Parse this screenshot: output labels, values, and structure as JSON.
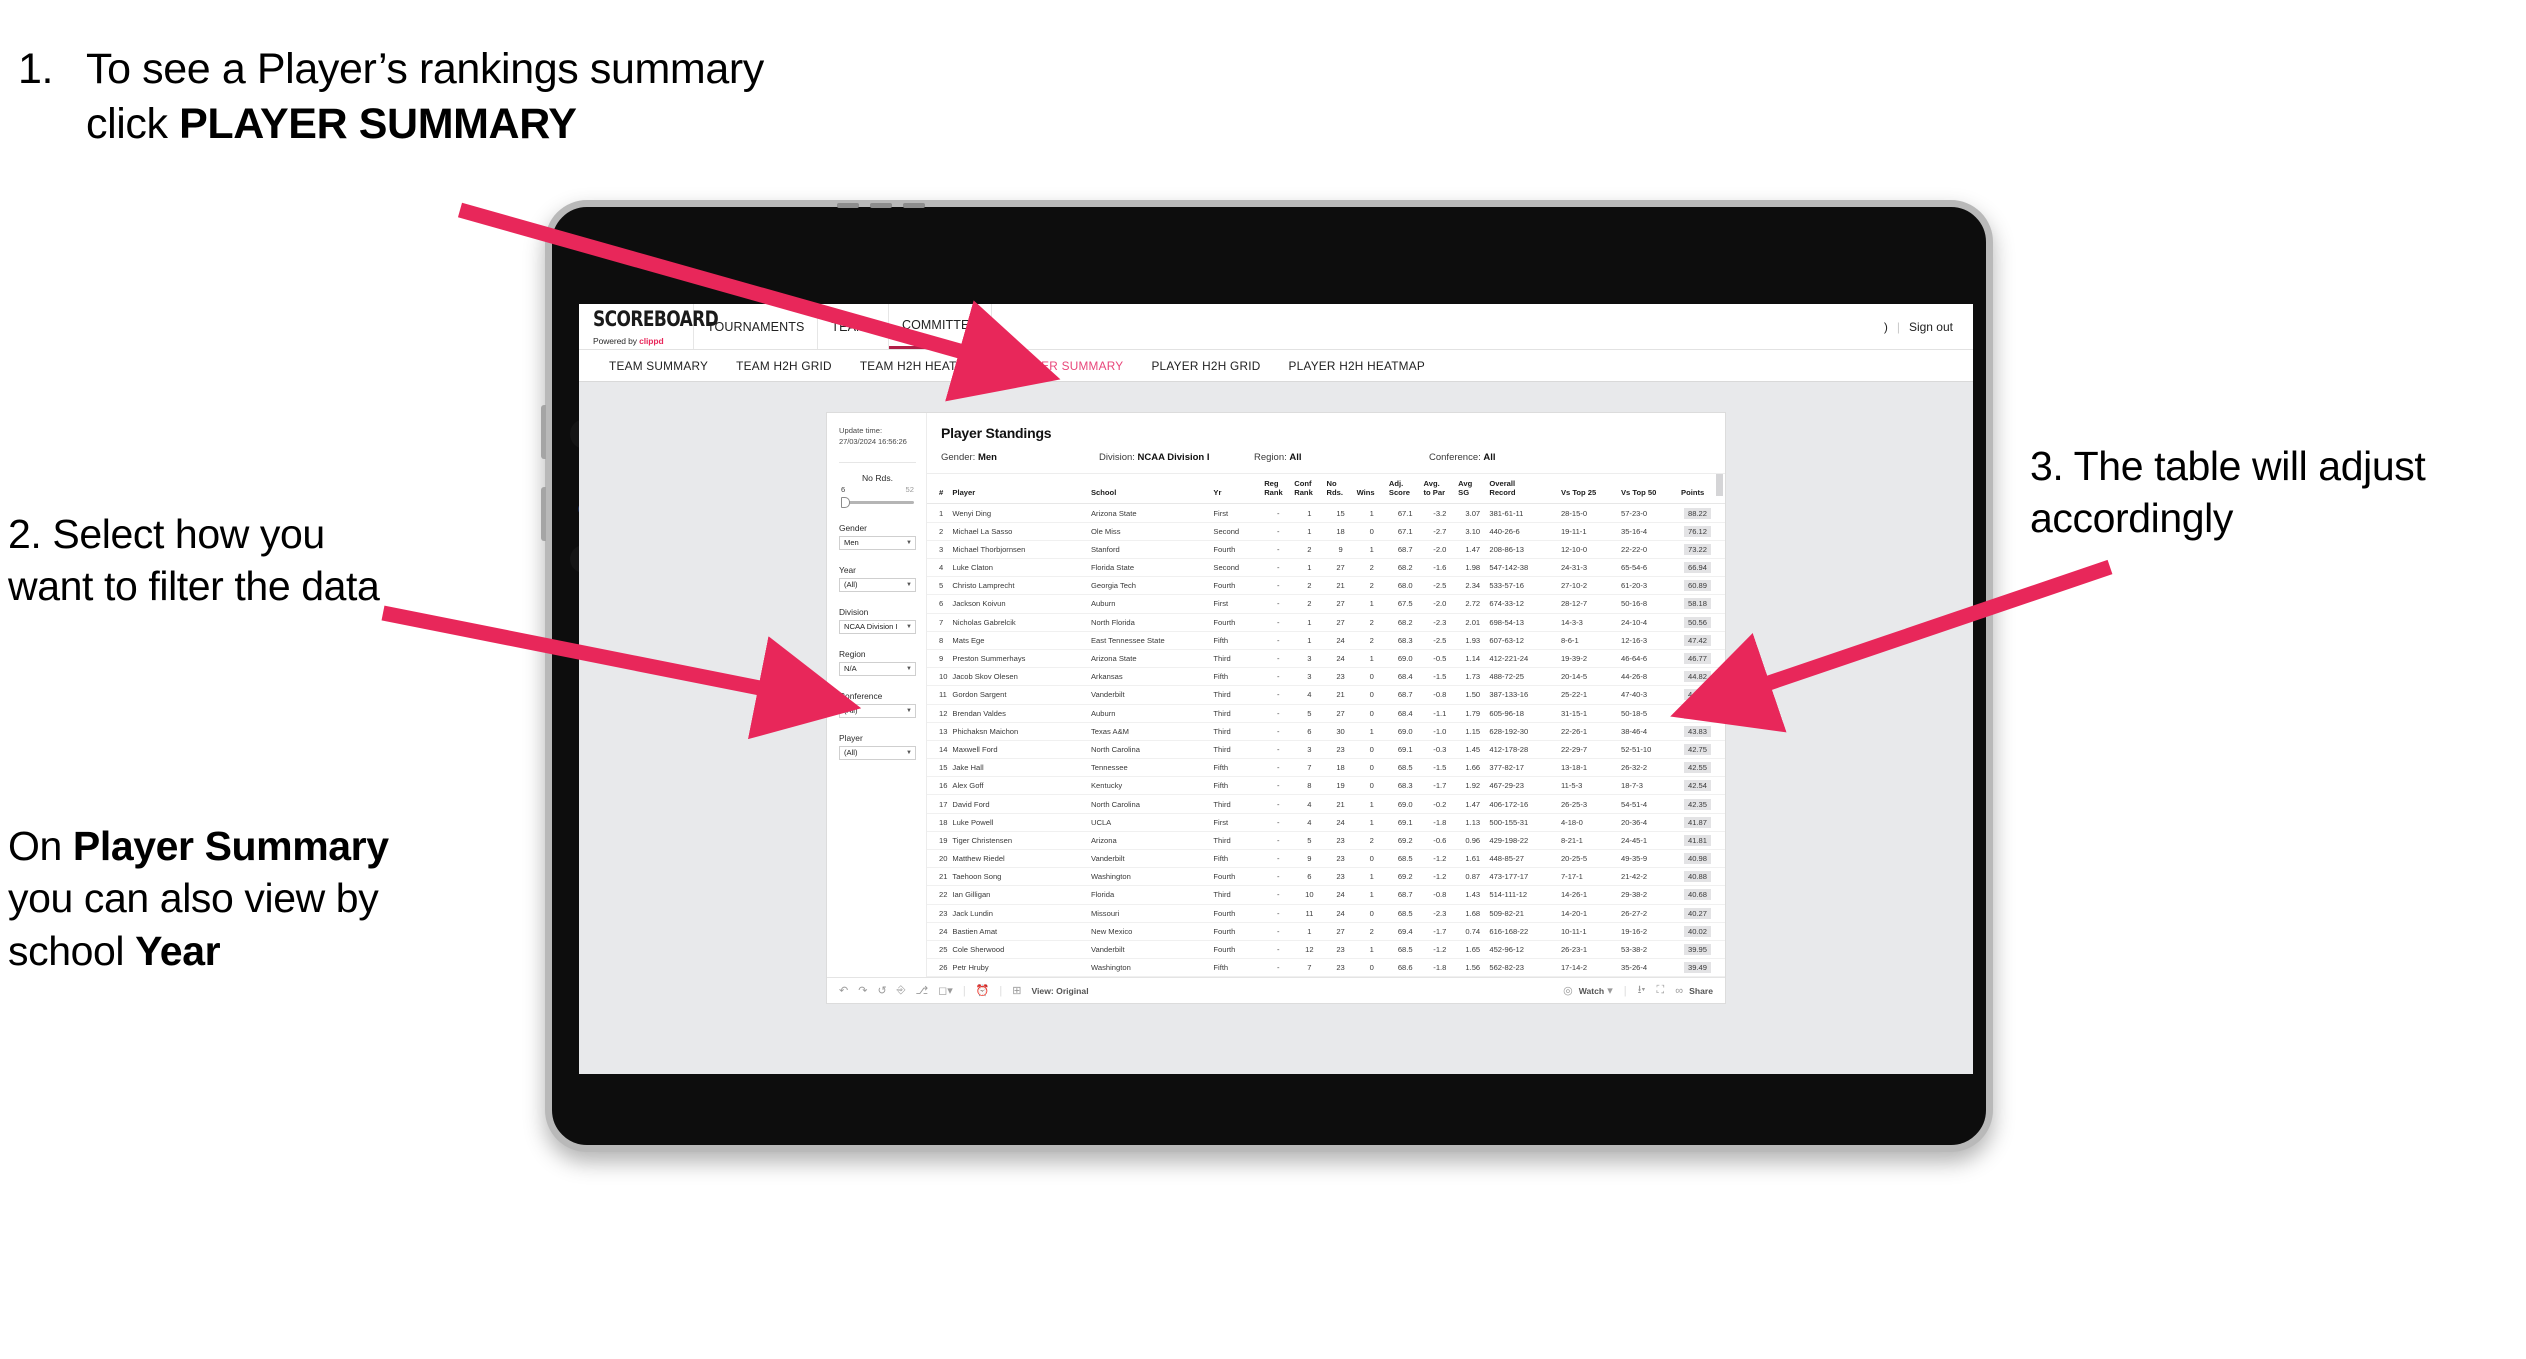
{
  "annotations": {
    "step1_num": "1.",
    "step1_pre": "To see a Player’s rankings summary click ",
    "step1_bold": "PLAYER SUMMARY",
    "step2": "2. Select how you want to filter the data",
    "step2b_pre": "On ",
    "step2b_bold1": "Player Summary",
    "step2b_mid": " you can also view by school ",
    "step2b_bold2": "Year",
    "step3": "3. The table will adjust accordingly",
    "arrow_color": "#e8275a"
  },
  "app": {
    "brand": {
      "name": "SCOREBOARD",
      "powered_pre": "Powered by ",
      "powered_brand": "clippd"
    },
    "top_nav": [
      {
        "label": "TOURNAMENTS",
        "active": false
      },
      {
        "label": "TEAMS",
        "active": false
      },
      {
        "label": "COMMITTEE",
        "active": true
      }
    ],
    "account": {
      "user_glyph": ")",
      "divider": "|",
      "sign_out": "Sign out"
    },
    "sub_nav": [
      {
        "label": "TEAM SUMMARY",
        "active": false
      },
      {
        "label": "TEAM H2H GRID",
        "active": false
      },
      {
        "label": "TEAM H2H HEATMAP",
        "active": false
      },
      {
        "label": "PLAYER SUMMARY",
        "active": true
      },
      {
        "label": "PLAYER H2H GRID",
        "active": false
      },
      {
        "label": "PLAYER H2H HEATMAP",
        "active": false
      }
    ]
  },
  "filters": {
    "update_label": "Update time:",
    "update_value": "27/03/2024 16:56:26",
    "slider": {
      "label": "No Rds.",
      "min": "6",
      "max": "52"
    },
    "selects": [
      {
        "label": "Gender",
        "value": "Men"
      },
      {
        "label": "Year",
        "value": "(All)"
      },
      {
        "label": "Division",
        "value": "NCAA Division I"
      },
      {
        "label": "Region",
        "value": "N/A"
      },
      {
        "label": "Conference",
        "value": "(All)"
      },
      {
        "label": "Player",
        "value": "(All)"
      }
    ]
  },
  "standings": {
    "title": "Player Standings",
    "meta": [
      {
        "label": "Gender: ",
        "value": "Men"
      },
      {
        "label": "Division: ",
        "value": "NCAA Division I"
      },
      {
        "label": "Region: ",
        "value": "All"
      },
      {
        "label": "Conference: ",
        "value": "All"
      }
    ],
    "columns": [
      {
        "l1": "#",
        "l2": ""
      },
      {
        "l1": "Player",
        "l2": ""
      },
      {
        "l1": "School",
        "l2": ""
      },
      {
        "l1": "Yr",
        "l2": ""
      },
      {
        "l1": "Reg",
        "l2": "Rank"
      },
      {
        "l1": "Conf",
        "l2": "Rank"
      },
      {
        "l1": "No",
        "l2": "Rds."
      },
      {
        "l1": "Wins",
        "l2": ""
      },
      {
        "l1": "Adj.",
        "l2": "Score"
      },
      {
        "l1": "Avg.",
        "l2": "to Par"
      },
      {
        "l1": "Avg",
        "l2": "SG"
      },
      {
        "l1": "Overall",
        "l2": "Record"
      },
      {
        "l1": "Vs Top 25",
        "l2": ""
      },
      {
        "l1": "Vs Top 50",
        "l2": ""
      },
      {
        "l1": "Points",
        "l2": ""
      }
    ],
    "rows": [
      {
        "rank": "1",
        "player": "Wenyi Ding",
        "school": "Arizona State",
        "yr": "First",
        "reg": "-",
        "conf": "1",
        "rds": "15",
        "wins": "1",
        "adj": "67.1",
        "par": "-3.2",
        "sg": "3.07",
        "record": "381-61-11",
        "t25": "28-15-0",
        "t50": "57-23-0",
        "points": "88.22"
      },
      {
        "rank": "2",
        "player": "Michael La Sasso",
        "school": "Ole Miss",
        "yr": "Second",
        "reg": "-",
        "conf": "1",
        "rds": "18",
        "wins": "0",
        "adj": "67.1",
        "par": "-2.7",
        "sg": "3.10",
        "record": "440-26-6",
        "t25": "19-11-1",
        "t50": "35-16-4",
        "points": "76.12"
      },
      {
        "rank": "3",
        "player": "Michael Thorbjornsen",
        "school": "Stanford",
        "yr": "Fourth",
        "reg": "-",
        "conf": "2",
        "rds": "9",
        "wins": "1",
        "adj": "68.7",
        "par": "-2.0",
        "sg": "1.47",
        "record": "208-86-13",
        "t25": "12-10-0",
        "t50": "22-22-0",
        "points": "73.22"
      },
      {
        "rank": "4",
        "player": "Luke Claton",
        "school": "Florida State",
        "yr": "Second",
        "reg": "-",
        "conf": "1",
        "rds": "27",
        "wins": "2",
        "adj": "68.2",
        "par": "-1.6",
        "sg": "1.98",
        "record": "547-142-38",
        "t25": "24-31-3",
        "t50": "65-54-6",
        "points": "66.94"
      },
      {
        "rank": "5",
        "player": "Christo Lamprecht",
        "school": "Georgia Tech",
        "yr": "Fourth",
        "reg": "-",
        "conf": "2",
        "rds": "21",
        "wins": "2",
        "adj": "68.0",
        "par": "-2.5",
        "sg": "2.34",
        "record": "533-57-16",
        "t25": "27-10-2",
        "t50": "61-20-3",
        "points": "60.89"
      },
      {
        "rank": "6",
        "player": "Jackson Koivun",
        "school": "Auburn",
        "yr": "First",
        "reg": "-",
        "conf": "2",
        "rds": "27",
        "wins": "1",
        "adj": "67.5",
        "par": "-2.0",
        "sg": "2.72",
        "record": "674-33-12",
        "t25": "28-12-7",
        "t50": "50-16-8",
        "points": "58.18"
      },
      {
        "rank": "7",
        "player": "Nicholas Gabrelcik",
        "school": "North Florida",
        "yr": "Fourth",
        "reg": "-",
        "conf": "1",
        "rds": "27",
        "wins": "2",
        "adj": "68.2",
        "par": "-2.3",
        "sg": "2.01",
        "record": "698-54-13",
        "t25": "14-3-3",
        "t50": "24-10-4",
        "points": "50.56"
      },
      {
        "rank": "8",
        "player": "Mats Ege",
        "school": "East Tennessee State",
        "yr": "Fifth",
        "reg": "-",
        "conf": "1",
        "rds": "24",
        "wins": "2",
        "adj": "68.3",
        "par": "-2.5",
        "sg": "1.93",
        "record": "607-63-12",
        "t25": "8-6-1",
        "t50": "12-16-3",
        "points": "47.42"
      },
      {
        "rank": "9",
        "player": "Preston Summerhays",
        "school": "Arizona State",
        "yr": "Third",
        "reg": "-",
        "conf": "3",
        "rds": "24",
        "wins": "1",
        "adj": "69.0",
        "par": "-0.5",
        "sg": "1.14",
        "record": "412-221-24",
        "t25": "19-39-2",
        "t50": "46-64-6",
        "points": "46.77"
      },
      {
        "rank": "10",
        "player": "Jacob Skov Olesen",
        "school": "Arkansas",
        "yr": "Fifth",
        "reg": "-",
        "conf": "3",
        "rds": "23",
        "wins": "0",
        "adj": "68.4",
        "par": "-1.5",
        "sg": "1.73",
        "record": "488-72-25",
        "t25": "20-14-5",
        "t50": "44-26-8",
        "points": "44.82"
      },
      {
        "rank": "11",
        "player": "Gordon Sargent",
        "school": "Vanderbilt",
        "yr": "Third",
        "reg": "-",
        "conf": "4",
        "rds": "21",
        "wins": "0",
        "adj": "68.7",
        "par": "-0.8",
        "sg": "1.50",
        "record": "387-133-16",
        "t25": "25-22-1",
        "t50": "47-40-3",
        "points": "44.49"
      },
      {
        "rank": "12",
        "player": "Brendan Valdes",
        "school": "Auburn",
        "yr": "Third",
        "reg": "-",
        "conf": "5",
        "rds": "27",
        "wins": "0",
        "adj": "68.4",
        "par": "-1.1",
        "sg": "1.79",
        "record": "605-96-18",
        "t25": "31-15-1",
        "t50": "50-18-5",
        "points": "43.95"
      },
      {
        "rank": "13",
        "player": "Phichaksn Maichon",
        "school": "Texas A&M",
        "yr": "Third",
        "reg": "-",
        "conf": "6",
        "rds": "30",
        "wins": "1",
        "adj": "69.0",
        "par": "-1.0",
        "sg": "1.15",
        "record": "628-192-30",
        "t25": "22-26-1",
        "t50": "38-46-4",
        "points": "43.83"
      },
      {
        "rank": "14",
        "player": "Maxwell Ford",
        "school": "North Carolina",
        "yr": "Third",
        "reg": "-",
        "conf": "3",
        "rds": "23",
        "wins": "0",
        "adj": "69.1",
        "par": "-0.3",
        "sg": "1.45",
        "record": "412-178-28",
        "t25": "22-29-7",
        "t50": "52-51-10",
        "points": "42.75"
      },
      {
        "rank": "15",
        "player": "Jake Hall",
        "school": "Tennessee",
        "yr": "Fifth",
        "reg": "-",
        "conf": "7",
        "rds": "18",
        "wins": "0",
        "adj": "68.5",
        "par": "-1.5",
        "sg": "1.66",
        "record": "377-82-17",
        "t25": "13-18-1",
        "t50": "26-32-2",
        "points": "42.55"
      },
      {
        "rank": "16",
        "player": "Alex Goff",
        "school": "Kentucky",
        "yr": "Fifth",
        "reg": "-",
        "conf": "8",
        "rds": "19",
        "wins": "0",
        "adj": "68.3",
        "par": "-1.7",
        "sg": "1.92",
        "record": "467-29-23",
        "t25": "11-5-3",
        "t50": "18-7-3",
        "points": "42.54"
      },
      {
        "rank": "17",
        "player": "David Ford",
        "school": "North Carolina",
        "yr": "Third",
        "reg": "-",
        "conf": "4",
        "rds": "21",
        "wins": "1",
        "adj": "69.0",
        "par": "-0.2",
        "sg": "1.47",
        "record": "406-172-16",
        "t25": "26-25-3",
        "t50": "54-51-4",
        "points": "42.35"
      },
      {
        "rank": "18",
        "player": "Luke Powell",
        "school": "UCLA",
        "yr": "First",
        "reg": "-",
        "conf": "4",
        "rds": "24",
        "wins": "1",
        "adj": "69.1",
        "par": "-1.8",
        "sg": "1.13",
        "record": "500-155-31",
        "t25": "4-18-0",
        "t50": "20-36-4",
        "points": "41.87"
      },
      {
        "rank": "19",
        "player": "Tiger Christensen",
        "school": "Arizona",
        "yr": "Third",
        "reg": "-",
        "conf": "5",
        "rds": "23",
        "wins": "2",
        "adj": "69.2",
        "par": "-0.6",
        "sg": "0.96",
        "record": "429-198-22",
        "t25": "8-21-1",
        "t50": "24-45-1",
        "points": "41.81"
      },
      {
        "rank": "20",
        "player": "Matthew Riedel",
        "school": "Vanderbilt",
        "yr": "Fifth",
        "reg": "-",
        "conf": "9",
        "rds": "23",
        "wins": "0",
        "adj": "68.5",
        "par": "-1.2",
        "sg": "1.61",
        "record": "448-85-27",
        "t25": "20-25-5",
        "t50": "49-35-9",
        "points": "40.98"
      },
      {
        "rank": "21",
        "player": "Taehoon Song",
        "school": "Washington",
        "yr": "Fourth",
        "reg": "-",
        "conf": "6",
        "rds": "23",
        "wins": "1",
        "adj": "69.2",
        "par": "-1.2",
        "sg": "0.87",
        "record": "473-177-17",
        "t25": "7-17-1",
        "t50": "21-42-2",
        "points": "40.88"
      },
      {
        "rank": "22",
        "player": "Ian Gilligan",
        "school": "Florida",
        "yr": "Third",
        "reg": "-",
        "conf": "10",
        "rds": "24",
        "wins": "1",
        "adj": "68.7",
        "par": "-0.8",
        "sg": "1.43",
        "record": "514-111-12",
        "t25": "14-26-1",
        "t50": "29-38-2",
        "points": "40.68"
      },
      {
        "rank": "23",
        "player": "Jack Lundin",
        "school": "Missouri",
        "yr": "Fourth",
        "reg": "-",
        "conf": "11",
        "rds": "24",
        "wins": "0",
        "adj": "68.5",
        "par": "-2.3",
        "sg": "1.68",
        "record": "509-82-21",
        "t25": "14-20-1",
        "t50": "26-27-2",
        "points": "40.27"
      },
      {
        "rank": "24",
        "player": "Bastien Amat",
        "school": "New Mexico",
        "yr": "Fourth",
        "reg": "-",
        "conf": "1",
        "rds": "27",
        "wins": "2",
        "adj": "69.4",
        "par": "-1.7",
        "sg": "0.74",
        "record": "616-168-22",
        "t25": "10-11-1",
        "t50": "19-16-2",
        "points": "40.02"
      },
      {
        "rank": "25",
        "player": "Cole Sherwood",
        "school": "Vanderbilt",
        "yr": "Fourth",
        "reg": "-",
        "conf": "12",
        "rds": "23",
        "wins": "1",
        "adj": "68.5",
        "par": "-1.2",
        "sg": "1.65",
        "record": "452-96-12",
        "t25": "26-23-1",
        "t50": "53-38-2",
        "points": "39.95"
      },
      {
        "rank": "26",
        "player": "Petr Hruby",
        "school": "Washington",
        "yr": "Fifth",
        "reg": "-",
        "conf": "7",
        "rds": "23",
        "wins": "0",
        "adj": "68.6",
        "par": "-1.8",
        "sg": "1.56",
        "record": "562-82-23",
        "t25": "17-14-2",
        "t50": "35-26-4",
        "points": "39.49"
      }
    ]
  },
  "viz_toolbar": {
    "view_label": "View: Original",
    "watch_label": "Watch",
    "share_label": "Share"
  }
}
